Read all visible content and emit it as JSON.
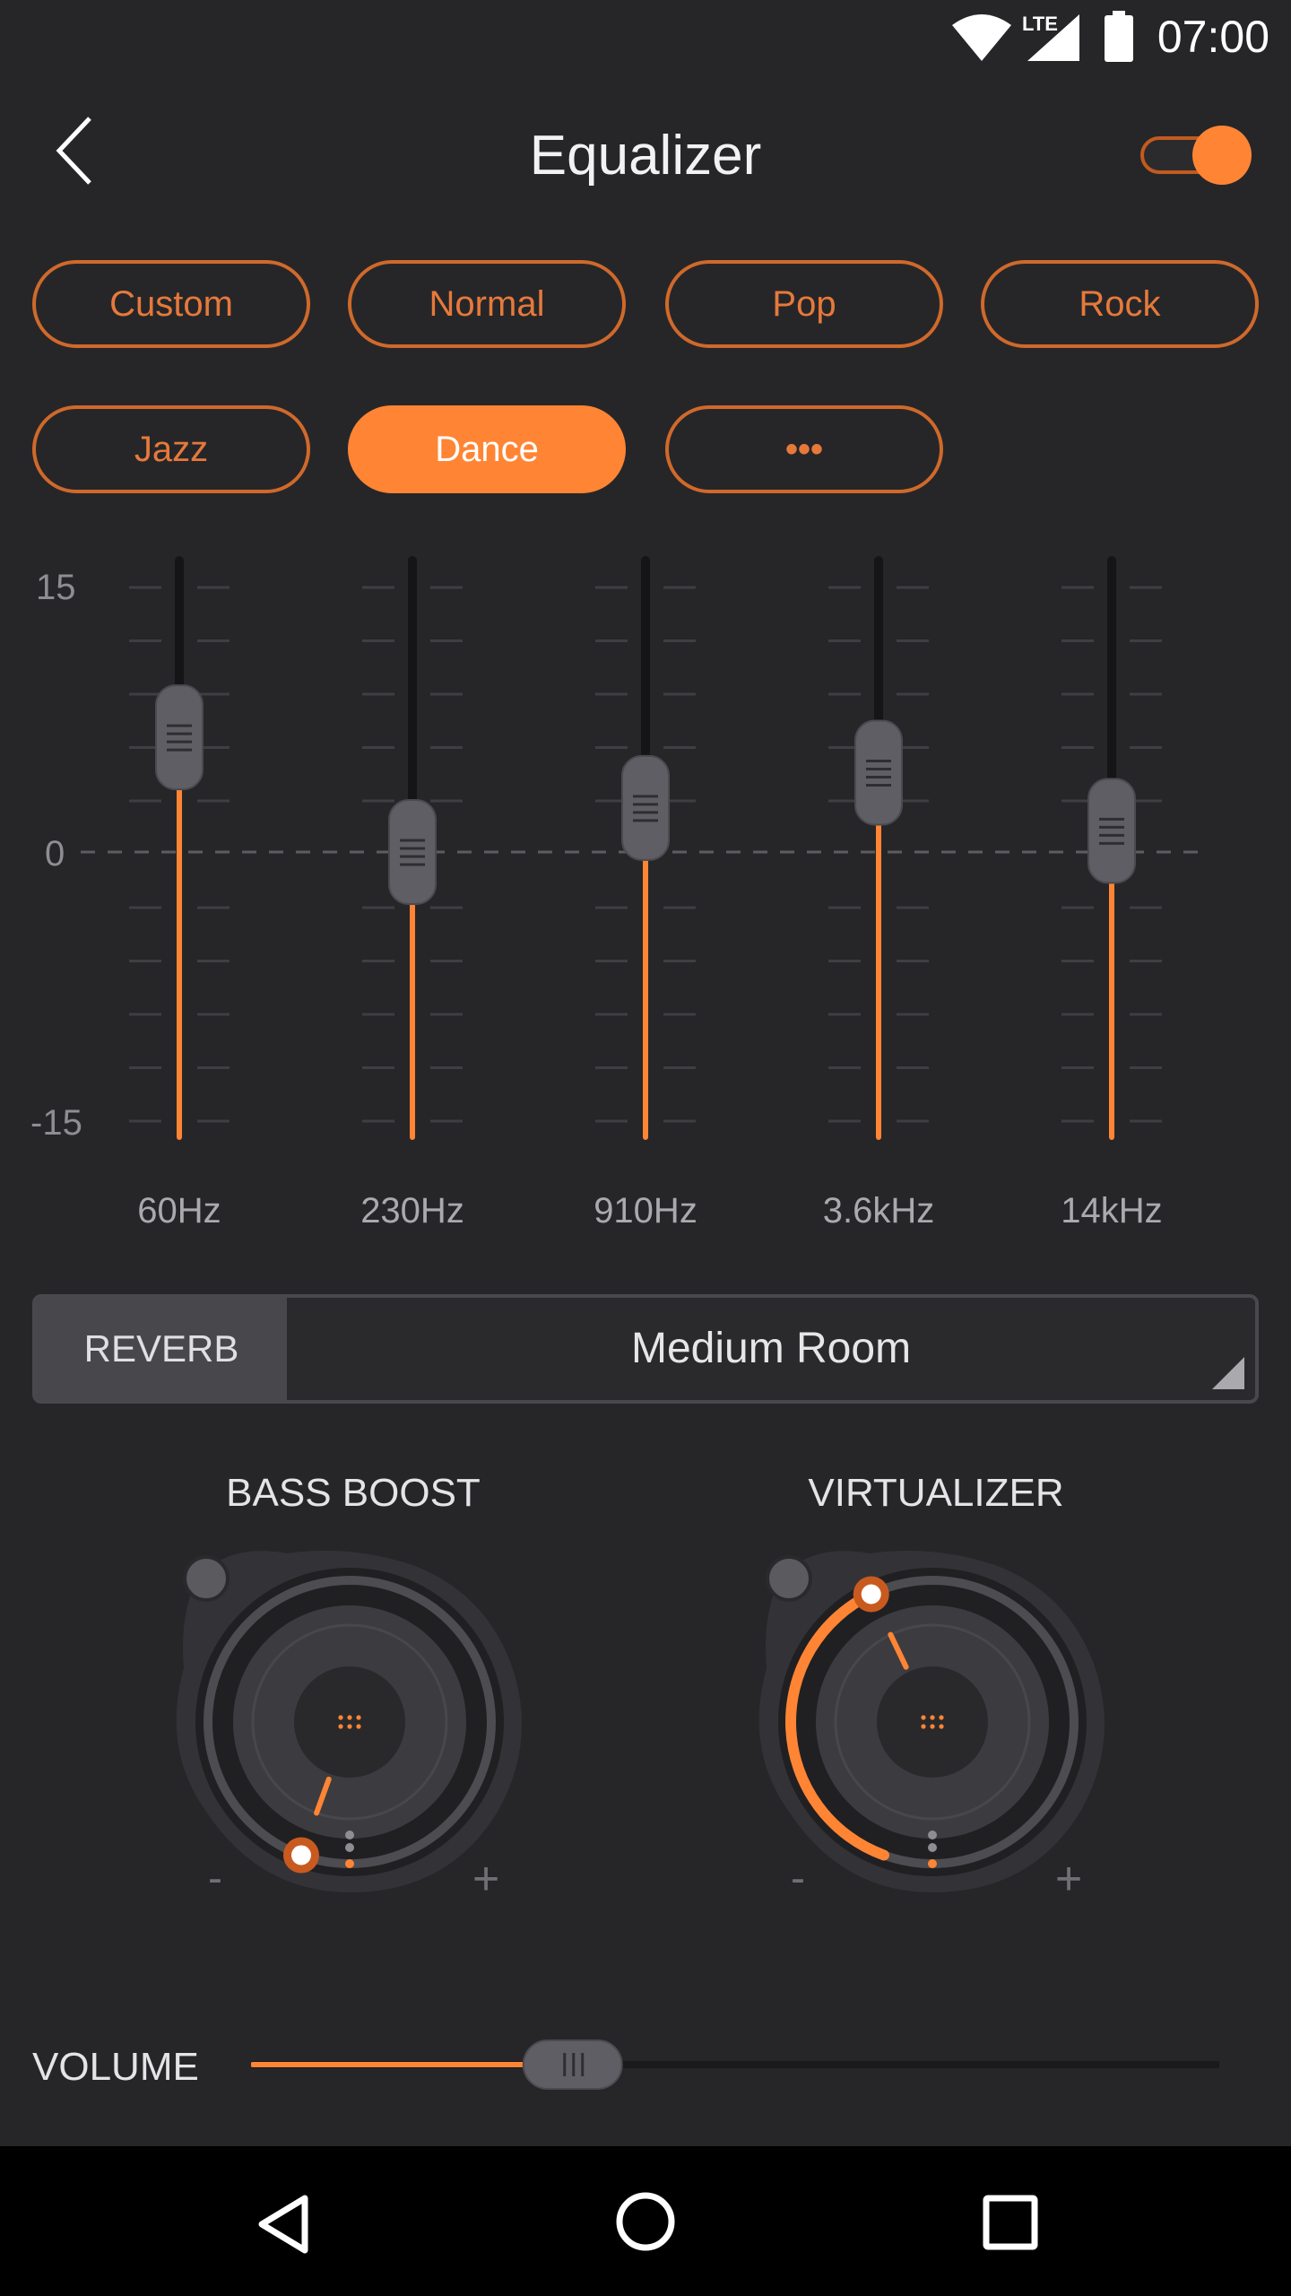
{
  "status_bar": {
    "time": "07:00",
    "icons": [
      "wifi-icon",
      "lte-signal-icon",
      "battery-icon"
    ],
    "network_label": "LTE"
  },
  "header": {
    "title": "Equalizer",
    "back_icon": "chevron-left-icon",
    "enabled": true
  },
  "presets": {
    "items": [
      "Custom",
      "Normal",
      "Pop",
      "Rock",
      "Jazz",
      "Dance",
      "•••"
    ],
    "selected": "Dance"
  },
  "equalizer": {
    "scale": {
      "max": "15",
      "zero": "0",
      "min": "-15"
    },
    "bands": [
      {
        "label": "60Hz",
        "gain_db": 6.5
      },
      {
        "label": "230Hz",
        "gain_db": 0.0
      },
      {
        "label": "910Hz",
        "gain_db": 2.5
      },
      {
        "label": "3.6kHz",
        "gain_db": 4.5
      },
      {
        "label": "14kHz",
        "gain_db": 1.2
      }
    ]
  },
  "reverb": {
    "label": "REVERB",
    "value": "Medium Room"
  },
  "bass_boost": {
    "title": "BASS BOOST",
    "level": 0.0,
    "minus": "-",
    "plus": "+"
  },
  "virtualizer": {
    "title": "VIRTUALIZER",
    "level": 0.42,
    "minus": "-",
    "plus": "+"
  },
  "volume": {
    "label": "VOLUME",
    "level": 0.33
  },
  "colors": {
    "accent": "#ff8534",
    "background": "#262629",
    "track": "#1a1a1c"
  },
  "nav_bar": {
    "icons": [
      "back-triangle-icon",
      "home-circle-icon",
      "recents-square-icon"
    ]
  }
}
